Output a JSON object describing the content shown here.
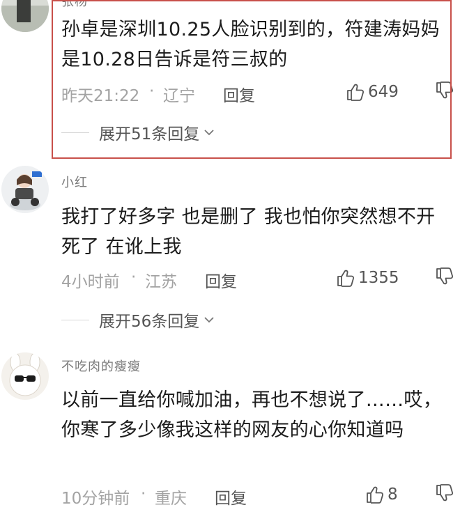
{
  "comments": [
    {
      "username": "张杨",
      "text": "孙卓是深圳10.25人脸识别到的，符建涛妈妈是10.28日告诉是符三叔的",
      "time": "昨天21:22",
      "location": "辽宁",
      "reply_label": "回复",
      "likes": "649",
      "expand_label": "展开51条回复",
      "highlighted": true
    },
    {
      "username": "小红",
      "text": "我打了好多字 也是删了 我也怕你突然想不开死了 在讹上我",
      "time": "4小时前",
      "location": "江苏",
      "reply_label": "回复",
      "likes": "1355",
      "expand_label": "展开56条回复"
    },
    {
      "username": "不吃肉的瘦瘦",
      "text": "以前一直给你喊加油，再也不想说了……哎，你寒了多少像我这样的网友的心你知道吗",
      "time": "10分钟前",
      "location": "重庆",
      "reply_label": "回复",
      "likes": "8"
    }
  ],
  "meta_separator": "·",
  "icons": {
    "like": "thumbs-up-icon",
    "dislike": "thumbs-down-icon",
    "expand": "chevron-down-icon"
  },
  "colors": {
    "highlight_border": "#c8504a",
    "meta_text": "#a3a3a3",
    "body_text": "#1c1c1c"
  }
}
